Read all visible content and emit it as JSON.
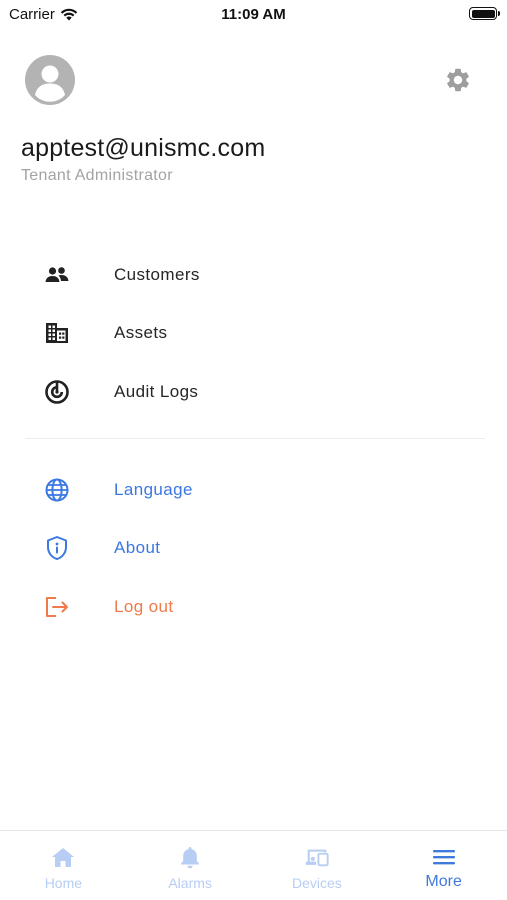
{
  "status_bar": {
    "carrier": "Carrier",
    "time": "11:09 AM"
  },
  "profile": {
    "email": "apptest@unismc.com",
    "role": "Tenant Administrator"
  },
  "menu": {
    "primary": [
      {
        "label": "Customers",
        "icon": "customers-icon"
      },
      {
        "label": "Assets",
        "icon": "building-icon"
      },
      {
        "label": "Audit Logs",
        "icon": "audit-logs-icon"
      }
    ],
    "secondary": [
      {
        "label": "Language",
        "icon": "globe-icon"
      },
      {
        "label": "About",
        "icon": "shield-info-icon"
      },
      {
        "label": "Log out",
        "icon": "logout-icon"
      }
    ]
  },
  "tab_bar": {
    "tabs": [
      {
        "label": "Home",
        "icon": "home-icon",
        "active": false
      },
      {
        "label": "Alarms",
        "icon": "bell-icon",
        "active": false
      },
      {
        "label": "Devices",
        "icon": "devices-icon",
        "active": false
      },
      {
        "label": "More",
        "icon": "menu-icon",
        "active": true
      }
    ]
  },
  "colors": {
    "accent_blue": "#3b78e3",
    "logout_orange": "#f07a4a",
    "inactive_tab": "#b7cdf4",
    "text_dark": "#262626",
    "text_muted": "#a3a3a3"
  }
}
